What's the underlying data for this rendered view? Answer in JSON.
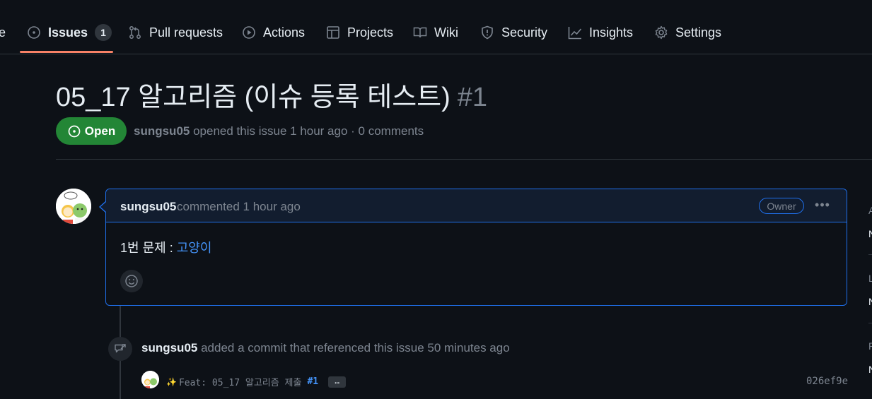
{
  "nav": {
    "partial_label": "e",
    "items": [
      {
        "label": "Issues",
        "icon": "issue-opened-icon",
        "counter": "1"
      },
      {
        "label": "Pull requests",
        "icon": "git-pull-request-icon"
      },
      {
        "label": "Actions",
        "icon": "play-icon"
      },
      {
        "label": "Projects",
        "icon": "table-icon"
      },
      {
        "label": "Wiki",
        "icon": "book-icon"
      },
      {
        "label": "Security",
        "icon": "shield-icon"
      },
      {
        "label": "Insights",
        "icon": "graph-icon"
      },
      {
        "label": "Settings",
        "icon": "gear-icon"
      }
    ]
  },
  "issue": {
    "title": "05_17 알고리즘 (이슈 등록 테스트)",
    "number": "#1",
    "state": "Open",
    "author": "sungsu05",
    "meta": "opened this issue 1 hour ago · 0 comments"
  },
  "comment": {
    "author": "sungsu05",
    "when": "commented 1 hour ago",
    "role": "Owner",
    "menu": "•••",
    "body_prefix": "1번 문제 : ",
    "body_link": "고양이"
  },
  "timeline": {
    "author": "sungsu05",
    "event_text": "added a commit that referenced this issue 50 minutes ago",
    "commit_emoji": "✨",
    "commit_message": "Feat: 05_17 알고리즘 제출",
    "commit_ref": "#1",
    "commit_more": "…",
    "sha": "026ef9e"
  },
  "sidebar_edge": {
    "letters": [
      "A",
      "N",
      "L",
      "N",
      "P",
      "N"
    ]
  },
  "colors": {
    "background": "#0d1117",
    "accent_underline": "#f78166",
    "open_green": "#238636",
    "link_blue": "#4493f8",
    "border_blue": "#1f6feb"
  }
}
